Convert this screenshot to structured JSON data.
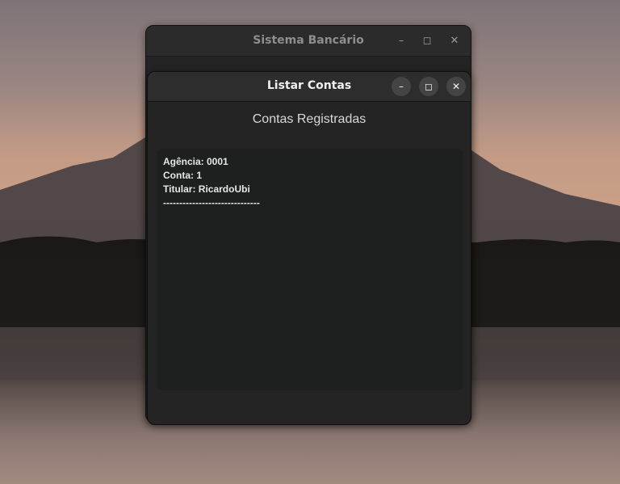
{
  "back_window": {
    "title": "Sistema Bancário",
    "minimize_glyph": "–",
    "maximize_glyph": "◻",
    "close_glyph": "✕"
  },
  "front_window": {
    "title": "Listar Contas",
    "minimize_glyph": "–",
    "maximize_glyph": "◻",
    "close_glyph": "✕",
    "heading": "Contas Registradas",
    "accounts": [
      {
        "agencia": "Agência: 0001",
        "conta": "Conta: 1",
        "titular": "Titular: RicardoUbi",
        "separator": "------------------------------"
      }
    ]
  }
}
